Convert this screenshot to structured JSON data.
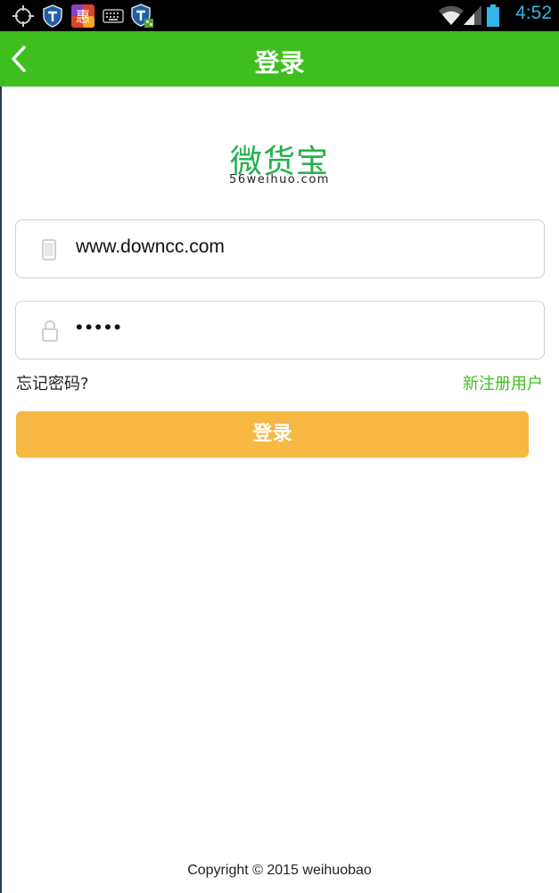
{
  "status_bar": {
    "time": "4:52",
    "icons": [
      "gps-icon",
      "shield-icon",
      "app-hui-icon",
      "keyboard-icon",
      "shield-badge-icon",
      "wifi-icon",
      "signal-icon",
      "battery-icon"
    ],
    "time_color": "#33b5e5"
  },
  "header": {
    "title": "登录",
    "back_icon": "chevron-left-icon",
    "bg_color": "#3fbf1f"
  },
  "logo": {
    "name_cn": "微货宝",
    "domain": "56weihuo.com",
    "color": "#22b14c"
  },
  "form": {
    "username": {
      "value": "www.downcc.com",
      "icon": "phone-icon"
    },
    "password": {
      "value": "•••••",
      "icon": "lock-icon"
    },
    "forgot_label": "忘记密码?",
    "register_label": "新注册用户",
    "login_label": "登录",
    "login_color": "#f6b842"
  },
  "footer": {
    "copyright": "Copyright © 2015 weihuobao"
  }
}
